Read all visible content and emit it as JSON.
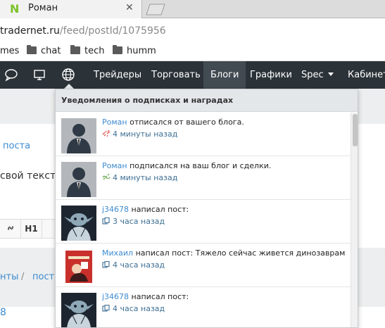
{
  "browser": {
    "tab_favicon": "N",
    "tab_title": "Роман",
    "close_glyph": "✕",
    "url_host": "tradernet.ru",
    "url_path": "/feed/postId/1075956",
    "bookmarks": [
      "mes",
      "chat",
      "tech",
      "humm"
    ]
  },
  "nav": {
    "items": [
      "Трейдеры",
      "Торговать",
      "Блоги",
      "Графики",
      "Spec",
      "Кабинет"
    ],
    "active_item": "Блоги",
    "icons": [
      "chat-bubble-icon",
      "monitor-icon",
      "globe-icon"
    ]
  },
  "page": {
    "link_fragment": "поста",
    "text_fragment": "свой текст",
    "toolbar": {
      "link_icon": "link-icon",
      "h1": "H1"
    },
    "breadcrumb": [
      "нты",
      "/",
      "пост"
    ],
    "number_fragment": "8"
  },
  "notifications": {
    "header": "Уведомления о подписках и наградах",
    "items": [
      {
        "user": "Роман",
        "action": " отписался от вашего блога.",
        "time": "4 минуты назад",
        "type": "unsubscribe",
        "avatar": "default-silhouette"
      },
      {
        "user": "Роман",
        "action": " подписался на ваш блог и сделки.",
        "time": "4 минуты назад",
        "type": "subscribe",
        "avatar": "default-silhouette"
      },
      {
        "user": "j34678",
        "action": " написал пост:",
        "time": "3 часа назад",
        "type": "post",
        "avatar": "yoda"
      },
      {
        "user": "Михаил",
        "action": " написал пост: Тяжело сейчас живется динозаврам",
        "time": "4 часа назад",
        "type": "post",
        "avatar": "poster"
      },
      {
        "user": "j34678",
        "action": " написал пост:",
        "time": "4 часа назад",
        "type": "post",
        "avatar": "yoda"
      }
    ]
  },
  "colors": {
    "nav_bg": "#2b3238",
    "link": "#3d8bd0",
    "favicon": "#7cc22a",
    "unsub_icon": "#d9534f",
    "sub_icon": "#6aa84f"
  }
}
